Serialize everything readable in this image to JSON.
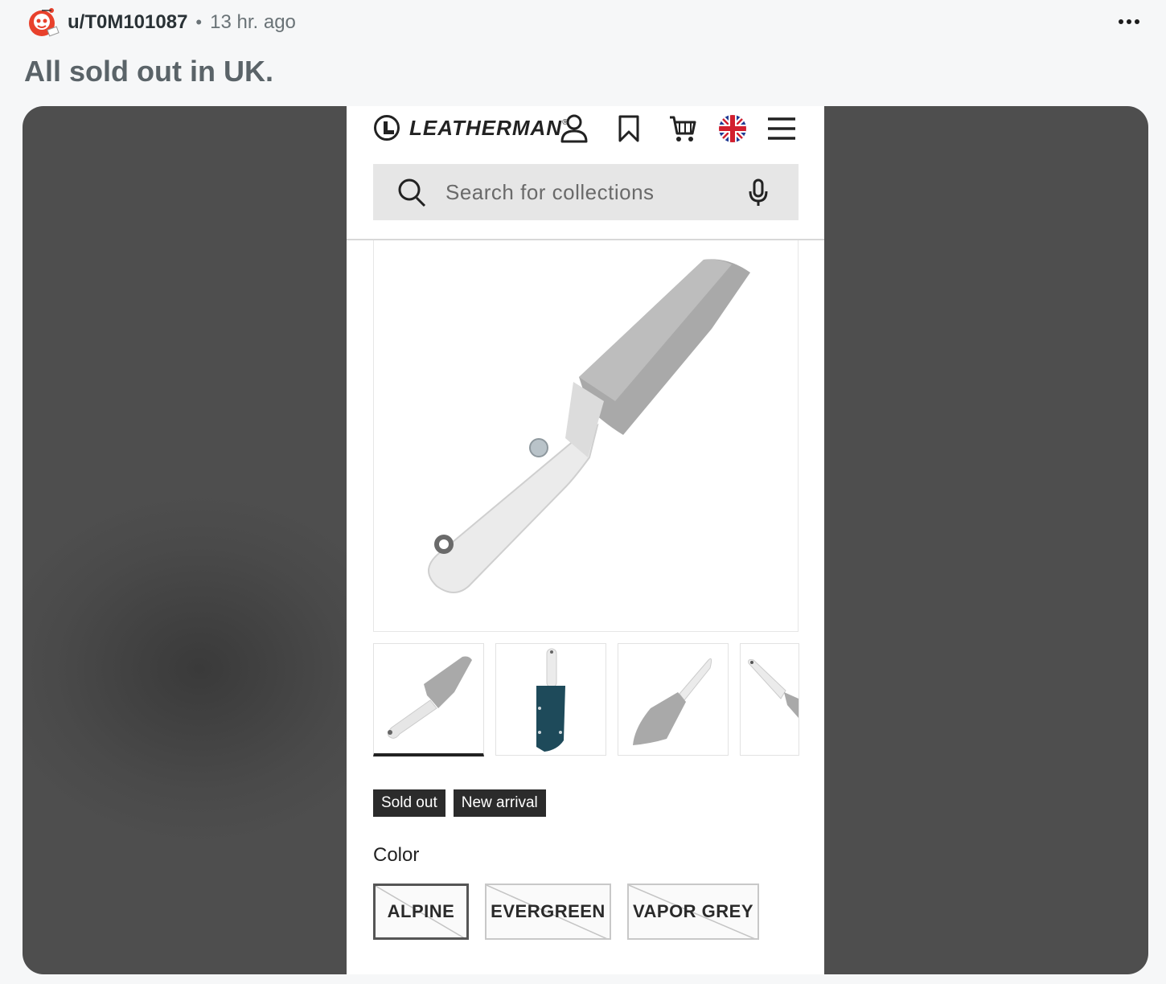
{
  "post": {
    "username": "u/T0M101087",
    "separator": "•",
    "time": "13 hr. ago",
    "title": "All sold out in UK."
  },
  "screenshot": {
    "brand": "LEATHERMAN",
    "brand_mark": "®",
    "search_placeholder": "Search for collections",
    "badges": [
      "Sold out",
      "New arrival"
    ],
    "color_label": "Color",
    "colors": [
      {
        "label": "ALPINE",
        "selected": true,
        "available": false
      },
      {
        "label": "EVERGREEN",
        "selected": false,
        "available": false
      },
      {
        "label": "VAPOR GREY",
        "selected": false,
        "available": false
      }
    ],
    "thumbnails_visible": 4,
    "active_thumbnail": 1
  },
  "icons": [
    "more-icon",
    "account-icon",
    "bookmark-icon",
    "cart-icon",
    "uk-flag-icon",
    "menu-icon",
    "search-icon",
    "microphone-icon"
  ]
}
